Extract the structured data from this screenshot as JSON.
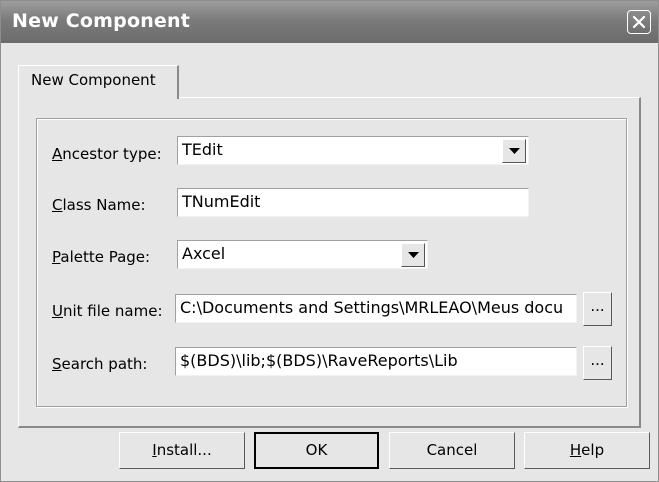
{
  "window": {
    "title": "New Component",
    "close_symbol": "×"
  },
  "tabs": [
    {
      "label": "New Component",
      "active": true
    }
  ],
  "form": {
    "ancestor_type": {
      "label_underlined": "A",
      "label_rest": "ncestor type:",
      "value": "TEdit"
    },
    "class_name": {
      "label_underlined": "C",
      "label_rest": "lass Name:",
      "value": "TNumEdit"
    },
    "palette_page": {
      "label_underlined": "P",
      "label_rest": "alette Page:",
      "value": "Axcel"
    },
    "unit_file_name": {
      "label_underlined": "U",
      "label_rest": "nit file name:",
      "value": "C:\\Documents and Settings\\MRLEAO\\Meus docu",
      "browse_label": "..."
    },
    "search_path": {
      "label_underlined": "S",
      "label_rest": "earch path:",
      "value": "$(BDS)\\lib;$(BDS)\\RaveReports\\Lib",
      "browse_label": "..."
    }
  },
  "buttons": {
    "install": {
      "underlined": "I",
      "rest": "nstall..."
    },
    "ok": {
      "label": "OK"
    },
    "cancel": {
      "label": "Cancel"
    },
    "help": {
      "underlined": "H",
      "rest": "elp"
    }
  },
  "icons": {
    "close": "close-icon",
    "dropdown": "chevron-down-icon"
  }
}
